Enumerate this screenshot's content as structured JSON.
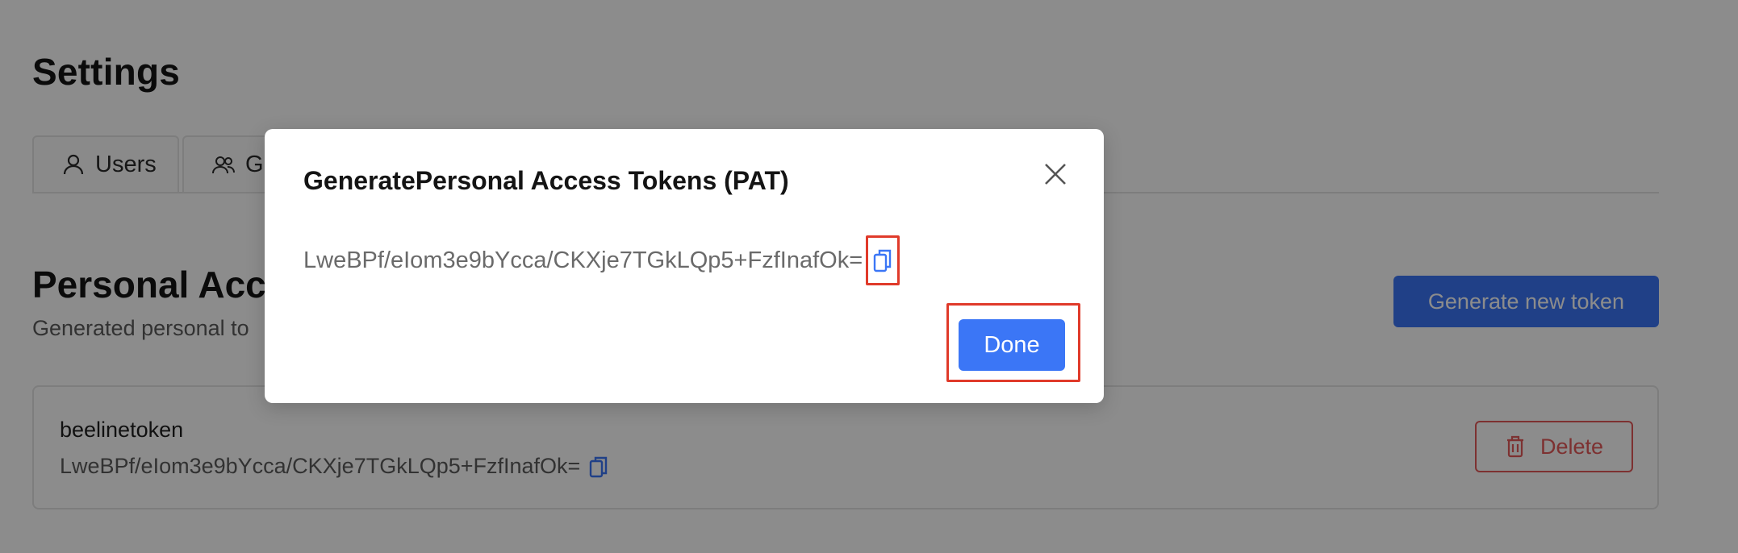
{
  "page": {
    "title": "Settings"
  },
  "tabs": [
    {
      "label": "Users",
      "icon": "user-icon"
    },
    {
      "label": "Gr",
      "icon": "group-icon"
    }
  ],
  "section": {
    "title": "Personal Acce",
    "subtitle": "Generated personal to",
    "generate_button": "Generate new token"
  },
  "token_card": {
    "name": "beelinetoken",
    "value": "LweBPf/eIom3e9bYcca/CKXje7TGkLQp5+FzfInafOk=",
    "copy_icon": "copy-icon",
    "delete_label": "Delete",
    "delete_icon": "trash-icon"
  },
  "modal": {
    "title": "GeneratePersonal Access Tokens (PAT)",
    "token": "LweBPf/eIom3e9bYcca/CKXje7TGkLQp5+FzfInafOk=",
    "close_icon": "close-icon",
    "copy_icon": "copy-icon",
    "done_label": "Done"
  },
  "colors": {
    "primary": "#3b76f6",
    "danger": "#e45a5a",
    "highlight": "#e03a2a",
    "overlay": "rgba(0,0,0,0.45)"
  }
}
